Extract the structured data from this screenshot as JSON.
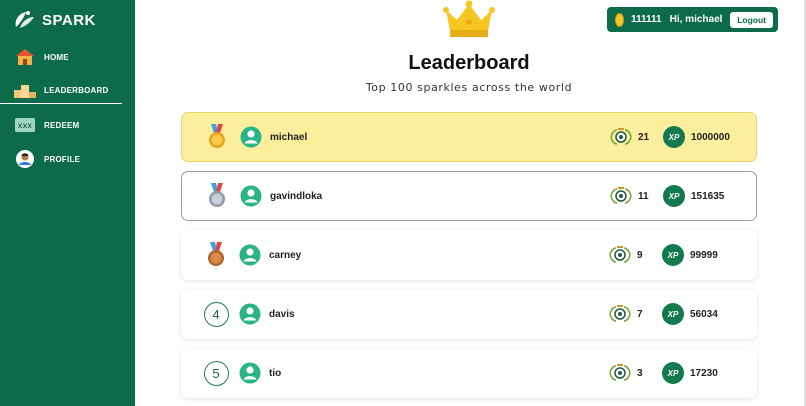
{
  "app": {
    "brand": "SPARK"
  },
  "sidebar": {
    "items": [
      {
        "label": "HOME",
        "icon": "home-icon"
      },
      {
        "label": "LEADERBOARD",
        "icon": "podium-icon",
        "active": true
      },
      {
        "label": "REDEEM",
        "icon": "ticket-icon"
      },
      {
        "label": "PROFILE",
        "icon": "profile-avatar-icon"
      }
    ]
  },
  "userbar": {
    "coins": "111111",
    "greeting": "Hi, michael",
    "logout_label": "Logout"
  },
  "header": {
    "title": "Leaderboard",
    "subtitle": "Top 100 sparkles across the world"
  },
  "leaderboard": [
    {
      "rank": "1",
      "medal": "gold",
      "name": "michael",
      "badges": "21",
      "score": "1000000"
    },
    {
      "rank": "2",
      "medal": "silver",
      "name": "gavindloka",
      "badges": "11",
      "score": "151635"
    },
    {
      "rank": "3",
      "medal": "bronze",
      "name": "carney",
      "badges": "9",
      "score": "99999"
    },
    {
      "rank": "4",
      "medal": "",
      "name": "davis",
      "badges": "7",
      "score": "56034"
    },
    {
      "rank": "5",
      "medal": "",
      "name": "tio",
      "badges": "3",
      "score": "17230"
    }
  ],
  "colors": {
    "primary": "#0d6b4c",
    "gold_row": "#fbee9d",
    "accent": "#137a4f",
    "coin": "#f4c430"
  }
}
